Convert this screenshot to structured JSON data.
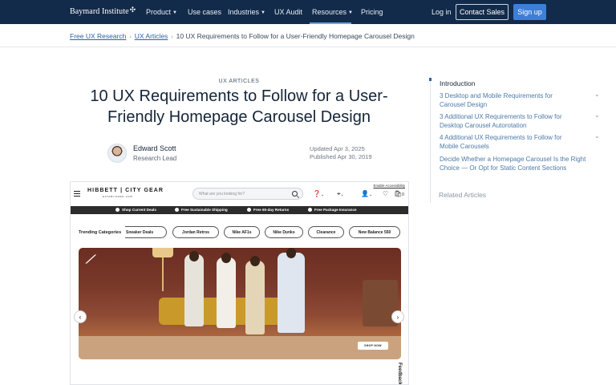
{
  "nav": {
    "logo": "Baymard Institute",
    "items": [
      {
        "label": "Product",
        "dropdown": true
      },
      {
        "label": "Use cases",
        "dropdown": false
      },
      {
        "label": "Industries",
        "dropdown": true
      },
      {
        "label": "UX Audit",
        "dropdown": false
      },
      {
        "label": "Resources",
        "dropdown": true,
        "active": true
      },
      {
        "label": "Pricing",
        "dropdown": false
      }
    ],
    "login": "Log in",
    "contact_sales": "Contact Sales",
    "signup": "Sign up"
  },
  "breadcrumb": {
    "items": [
      "Free UX Research",
      "UX Articles"
    ],
    "current": "10 UX Requirements to Follow for a User-Friendly Homepage Carousel Design"
  },
  "article": {
    "kicker": "UX ARTICLES",
    "title": "10 UX Requirements to Follow for a User-Friendly Homepage Carousel Design",
    "author_name": "Edward Scott",
    "author_role": "Research Lead",
    "updated": "Updated Apr 3, 2025",
    "published": "Published Apr 30, 2019"
  },
  "screenshot": {
    "enable_accessibility": "Enable Accessibility",
    "brand": "HIBBETT | CITY GEAR",
    "brand_sub": "ESTABLISHED 1945",
    "search_placeholder": "What are you looking for?",
    "strip": [
      "Shop Current Deals",
      "Free Sustainable Shipping",
      "Free 60-day Returns",
      "Free Package Insurance"
    ],
    "trending_label": "Trending Categories",
    "pills": [
      "Sneaker Deals",
      "Jordan Retros",
      "Nike AF1s",
      "Nike Dunks",
      "Clearance",
      "New Balance 550"
    ],
    "shop_now": "SHOP NOW",
    "feedback": "Feedback",
    "cart_count": "0"
  },
  "toc": {
    "intro": "Introduction",
    "items": [
      {
        "label": "3 Desktop and Mobile Requirements for Carousel Design",
        "expandable": true
      },
      {
        "label": "3 Additional UX Requirements to Follow for Desktop Carousel Autorotation",
        "expandable": true
      },
      {
        "label": "4 Additional UX Requirements to Follow for Mobile Carousels",
        "expandable": true
      },
      {
        "label": "Decide Whether a Homepage Carousel Is the Right Choice — Or Opt for Static Content Sections",
        "expandable": false
      }
    ],
    "related": "Related Articles"
  }
}
